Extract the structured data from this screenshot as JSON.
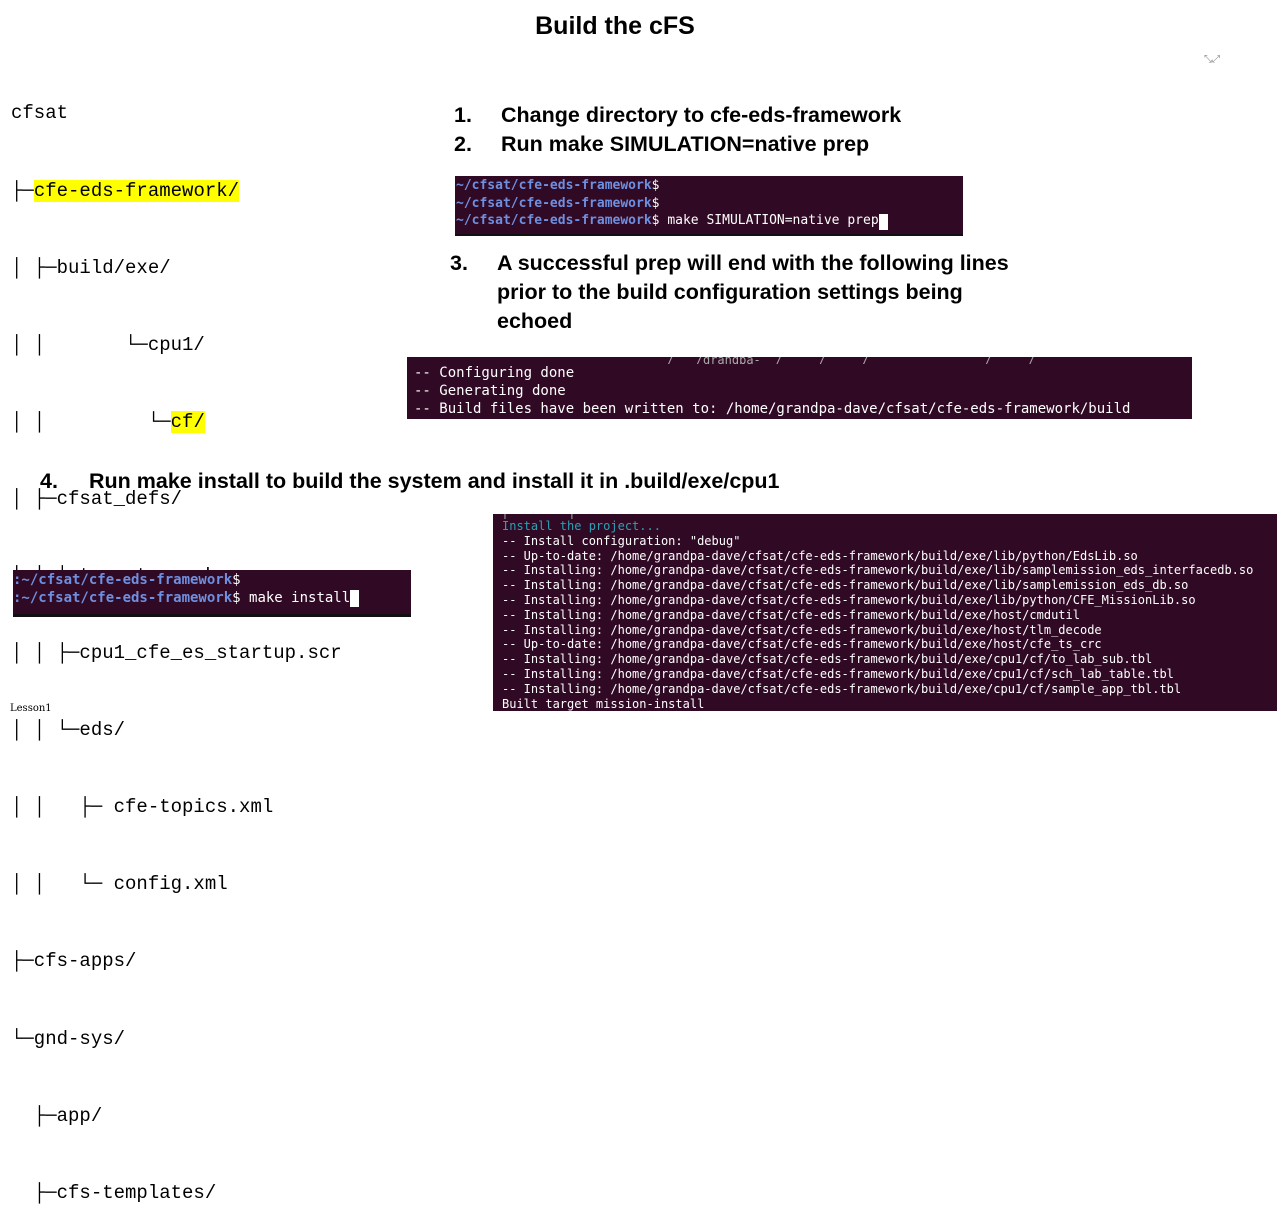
{
  "slide": {
    "title": "Build the cFS",
    "footer_left": "Lesson1",
    "corner_glyph": "⤡⤢"
  },
  "tree": {
    "lines": [
      {
        "prefix": "cfsat",
        "label": "",
        "highlight": false
      },
      {
        "prefix": "├─",
        "label": "cfe-eds-framework/",
        "highlight": true
      },
      {
        "prefix": "│ ├─build/exe/",
        "label": "",
        "highlight": false
      },
      {
        "prefix": "│ │       └─cpu1/",
        "label": "",
        "highlight": false
      },
      {
        "prefix": "│ │         └─",
        "label": "cf/",
        "highlight": true
      },
      {
        "prefix": "│ ├─cfsat_defs/",
        "label": "",
        "highlight": false
      },
      {
        "prefix": "│ │ ├─targets.cmake",
        "label": "",
        "highlight": false
      },
      {
        "prefix": "│ │ ├─cpu1_cfe_es_startup.scr",
        "label": "",
        "highlight": false
      },
      {
        "prefix": "│ │ └─eds/",
        "label": "",
        "highlight": false
      },
      {
        "prefix": "│ │   ├─ cfe-topics.xml",
        "label": "",
        "highlight": false
      },
      {
        "prefix": "│ │   └─ config.xml",
        "label": "",
        "highlight": false
      },
      {
        "prefix": "├─cfs-apps/",
        "label": "",
        "highlight": false
      },
      {
        "prefix": "└─gnd-sys/",
        "label": "",
        "highlight": false
      },
      {
        "prefix": "  ├─app/",
        "label": "",
        "highlight": false
      },
      {
        "prefix": "  ├─cfs-templates/",
        "label": "",
        "highlight": false
      }
    ]
  },
  "steps": {
    "s1": {
      "num": "1.",
      "text": "Change directory to cfe-eds-framework"
    },
    "s2": {
      "num": "2.",
      "text": "Run make SIMULATION=native prep"
    },
    "s3": {
      "num": "3.",
      "lines": [
        "A successful prep will end with the following lines",
        "prior to the build configuration settings being",
        "echoed"
      ]
    },
    "s4": {
      "num": "4.",
      "text": "Run make install to build the system and install it in .build/exe/cpu1"
    }
  },
  "terminal_prep": {
    "lines": [
      {
        "path": "~/cfsat/cfe-eds-framework",
        "suffix": "$"
      },
      {
        "path": "~/cfsat/cfe-eds-framework",
        "suffix": "$"
      },
      {
        "path": "~/cfsat/cfe-eds-framework",
        "suffix": "$ make SIMULATION=native prep"
      }
    ]
  },
  "terminal_cmake": {
    "top_fragment": "                                   /   /grandpa-  /     /     /                /     /",
    "lines": [
      "-- Configuring done",
      "-- Generating done",
      "-- Build files have been written to: /home/grandpa-dave/cfsat/cfe-eds-framework/build"
    ]
  },
  "terminal_install_cmd": {
    "lines": [
      {
        "path": ":~/cfsat/cfe-eds-framework",
        "suffix": "$"
      },
      {
        "path": ":~/cfsat/cfe-eds-framework",
        "suffix": "$ make install"
      }
    ]
  },
  "terminal_install_out": {
    "top_fragment": "[         ]              _     _     _    _   _",
    "header": "Install the project...",
    "lines": [
      "-- Install configuration: \"debug\"",
      "-- Up-to-date: /home/grandpa-dave/cfsat/cfe-eds-framework/build/exe/lib/python/EdsLib.so",
      "-- Installing: /home/grandpa-dave/cfsat/cfe-eds-framework/build/exe/lib/samplemission_eds_interfacedb.so",
      "-- Installing: /home/grandpa-dave/cfsat/cfe-eds-framework/build/exe/lib/samplemission_eds_db.so",
      "-- Installing: /home/grandpa-dave/cfsat/cfe-eds-framework/build/exe/lib/python/CFE_MissionLib.so",
      "-- Installing: /home/grandpa-dave/cfsat/cfe-eds-framework/build/exe/host/cmdutil",
      "-- Installing: /home/grandpa-dave/cfsat/cfe-eds-framework/build/exe/host/tlm_decode",
      "-- Up-to-date: /home/grandpa-dave/cfsat/cfe-eds-framework/build/exe/host/cfe_ts_crc",
      "-- Installing: /home/grandpa-dave/cfsat/cfe-eds-framework/build/exe/cpu1/cf/to_lab_sub.tbl",
      "-- Installing: /home/grandpa-dave/cfsat/cfe-eds-framework/build/exe/cpu1/cf/sch_lab_table.tbl",
      "-- Installing: /home/grandpa-dave/cfsat/cfe-eds-framework/build/exe/cpu1/cf/sample_app_tbl.tbl"
    ],
    "footer": "Built target mission-install"
  }
}
